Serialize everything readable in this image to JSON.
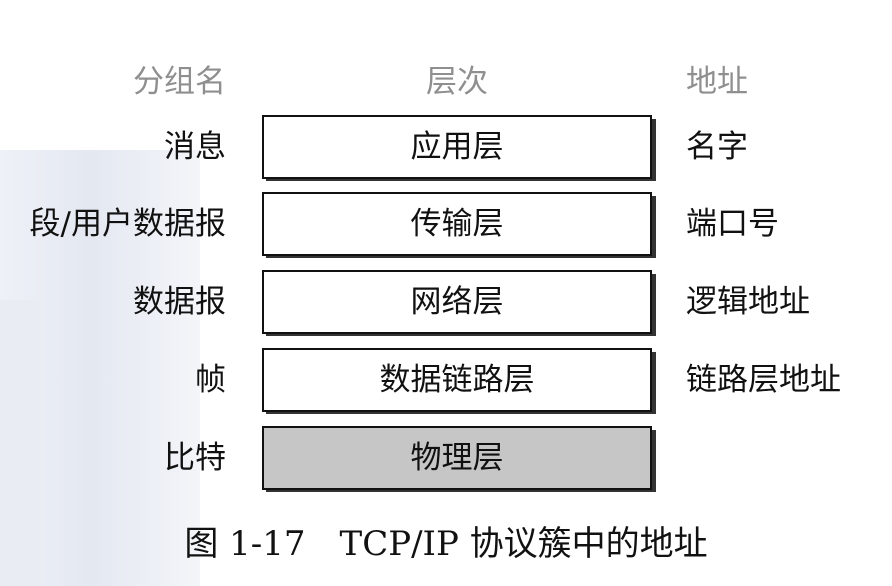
{
  "headers": {
    "packet_unit": "分组名",
    "layer": "层次",
    "address": "地址"
  },
  "rows": [
    {
      "unit": "消息",
      "layer": "应用层",
      "address": "名字"
    },
    {
      "unit": "段/用户数据报",
      "layer": "传输层",
      "address": "端口号"
    },
    {
      "unit": "数据报",
      "layer": "网络层",
      "address": "逻辑地址"
    },
    {
      "unit": "帧",
      "layer": "数据链路层",
      "address": "链路层地址"
    },
    {
      "unit": "比特",
      "layer": "物理层",
      "address": ""
    }
  ],
  "caption": "图 1-17　TCP/IP 协议簇中的地址",
  "colors": {
    "header_text": "#8f8f8f",
    "physical_layer_fill": "#c6c6c6",
    "box_fill": "#ffffff",
    "box_border": "#111111"
  }
}
